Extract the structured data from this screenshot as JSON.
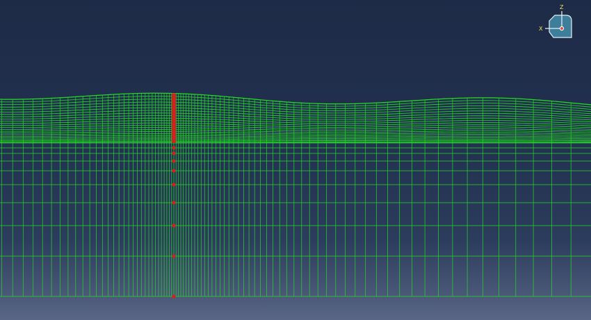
{
  "triad": {
    "z_label": "Z",
    "x_label": "X",
    "icon": "view-orientation-triad-icon"
  },
  "colors": {
    "mesh_line": "#22dd22",
    "selected_node_set": "#d42020",
    "background_top": "#1e2b47",
    "background_bottom": "#5a6684",
    "triad_face": "#3d7f9a"
  }
}
